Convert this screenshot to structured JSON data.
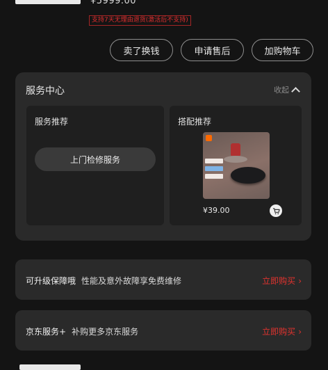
{
  "header": {
    "price": "¥5999.00",
    "notice": "支持7天无理由退货(激活后不支持)"
  },
  "actions": [
    {
      "label": "卖了换钱"
    },
    {
      "label": "申请售后"
    },
    {
      "label": "加购物车"
    }
  ],
  "service_center": {
    "title": "服务中心",
    "collapse_label": "收起",
    "recommend": {
      "title": "服务推荐",
      "button_label": "上门检修服务"
    },
    "combo": {
      "title": "搭配推荐",
      "price": "¥39.00",
      "cart_icon": "shopping-cart-icon"
    }
  },
  "upgrade_row": {
    "title": "可升级保障哦",
    "desc": "性能及意外故障享免费维修",
    "buy_label": "立即购买",
    "arrow": "›"
  },
  "jd_row": {
    "title": "京东服务+",
    "desc": "补购更多京东服务",
    "buy_label": "立即购买",
    "arrow": "›"
  },
  "colors": {
    "accent_red": "#e3332e",
    "card_bg": "#2a2a2a",
    "page_bg": "#141414"
  }
}
